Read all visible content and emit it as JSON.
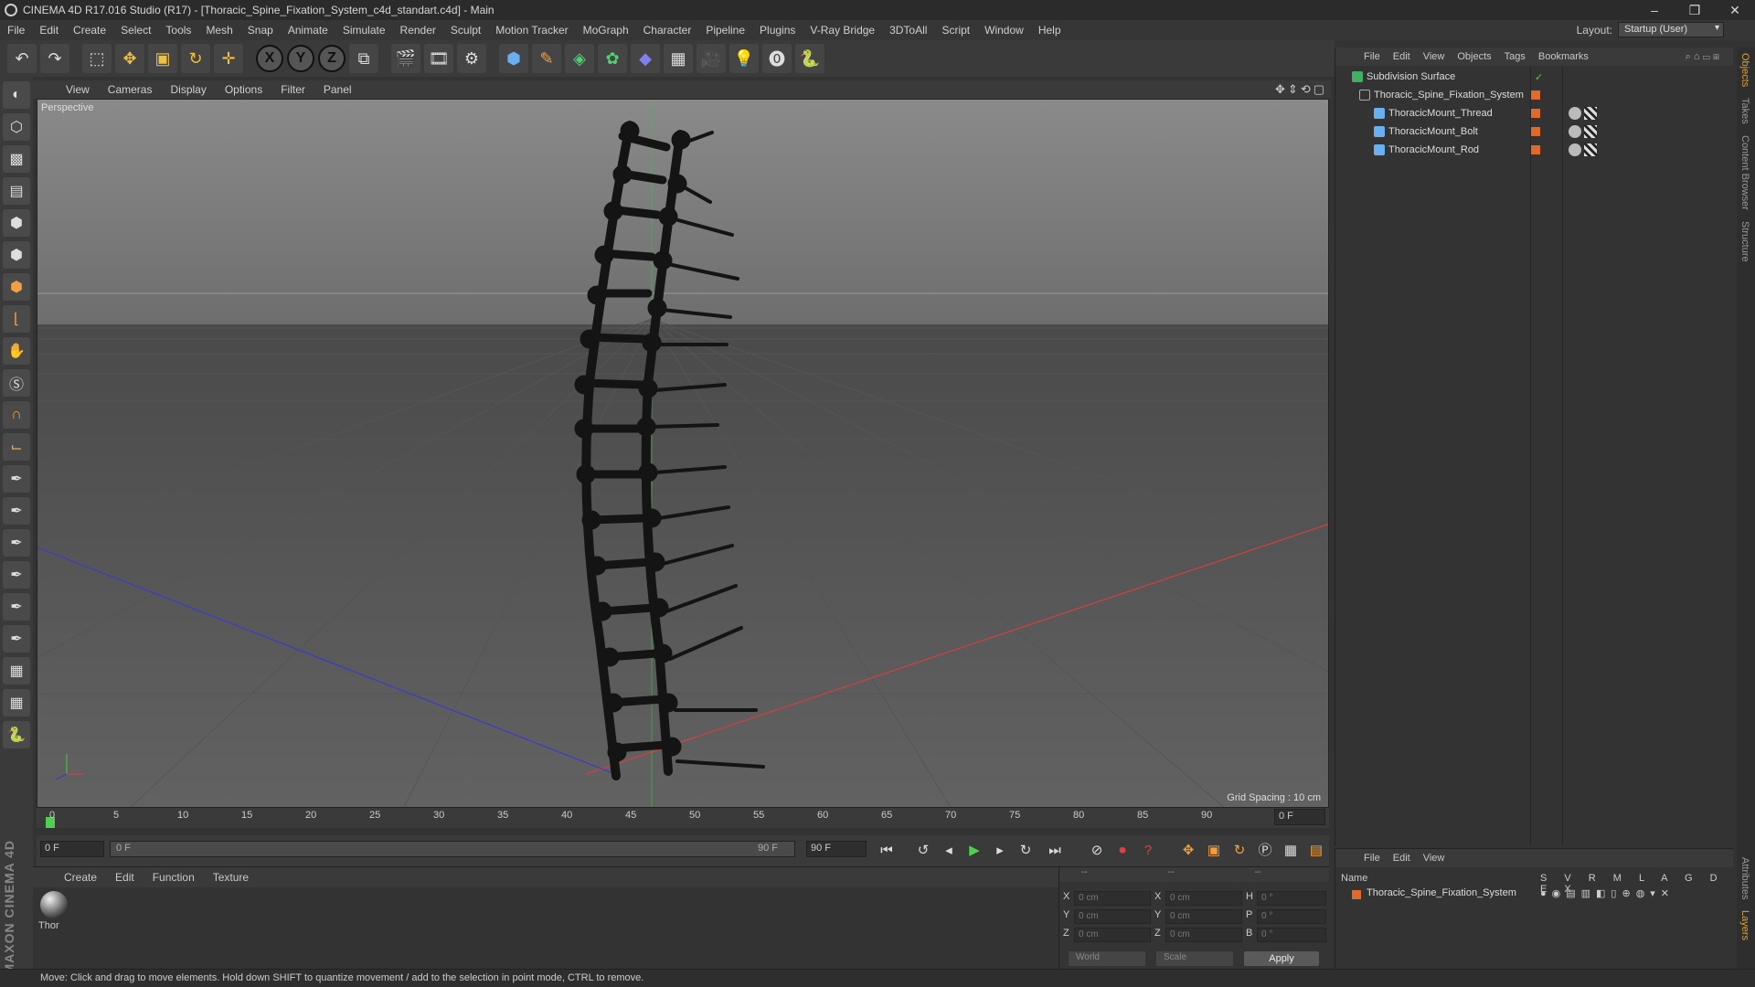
{
  "window": {
    "title": "CINEMA 4D R17.016 Studio (R17) - [Thoracic_Spine_Fixation_System_c4d_standart.c4d] - Main",
    "controls": [
      "–",
      "❐",
      "✕"
    ]
  },
  "menubar": {
    "items": [
      "File",
      "Edit",
      "Create",
      "Select",
      "Tools",
      "Mesh",
      "Snap",
      "Animate",
      "Simulate",
      "Render",
      "Sculpt",
      "Motion Tracker",
      "MoGraph",
      "Character",
      "Pipeline",
      "Plugins",
      "V-Ray Bridge",
      "3DToAll",
      "Script",
      "Window",
      "Help"
    ],
    "layout_label": "Layout:",
    "layout_value": "Startup (User)"
  },
  "toolbar": {
    "axis_x": "X",
    "axis_y": "Y",
    "axis_z": "Z"
  },
  "viewport": {
    "menu": [
      "View",
      "Cameras",
      "Display",
      "Options",
      "Filter",
      "Panel"
    ],
    "camera_label": "Perspective",
    "grid_spacing": "Grid Spacing : 10 cm"
  },
  "timeline": {
    "ticks": [
      "0",
      "5",
      "10",
      "15",
      "20",
      "25",
      "30",
      "35",
      "40",
      "45",
      "50",
      "55",
      "60",
      "65",
      "70",
      "75",
      "80",
      "85",
      "90"
    ],
    "current_frame": "0 F"
  },
  "transport": {
    "start_field": "0 F",
    "slider_start": "0 F",
    "slider_end": "90 F",
    "end_field": "90 F"
  },
  "materials": {
    "menu": [
      "Create",
      "Edit",
      "Function",
      "Texture"
    ],
    "material_name": "Thor"
  },
  "coords": {
    "header": [
      "--",
      "--",
      "--"
    ],
    "rows": [
      {
        "axis": "X",
        "pos": "0 cm",
        "axis2": "X",
        "size": "0 cm",
        "rot_axis": "H",
        "rot": "0 °"
      },
      {
        "axis": "Y",
        "pos": "0 cm",
        "axis2": "Y",
        "size": "0 cm",
        "rot_axis": "P",
        "rot": "0 °"
      },
      {
        "axis": "Z",
        "pos": "0 cm",
        "axis2": "Z",
        "size": "0 cm",
        "rot_axis": "B",
        "rot": "0 °"
      }
    ],
    "mode": "World",
    "transform": "Scale",
    "apply": "Apply"
  },
  "object_manager": {
    "menu": [
      "File",
      "Edit",
      "View",
      "Objects",
      "Tags",
      "Bookmarks"
    ],
    "objects": [
      {
        "name": "Subdivision Surface",
        "depth": 0
      },
      {
        "name": "Thoracic_Spine_Fixation_System",
        "depth": 1
      },
      {
        "name": "ThoracicMount_Thread",
        "depth": 2
      },
      {
        "name": "ThoracicMount_Bolt",
        "depth": 2
      },
      {
        "name": "ThoracicMount_Rod",
        "depth": 2
      }
    ]
  },
  "layers": {
    "menu": [
      "File",
      "Edit",
      "View"
    ],
    "name_header": "Name",
    "columns": "S V R M L A G D E X",
    "layer_name": "Thoracic_Spine_Fixation_System"
  },
  "side_tabs": [
    "Objects",
    "Takes",
    "Content Browser",
    "Structure"
  ],
  "side_tabs_bottom": [
    "Attributes",
    "Layers"
  ],
  "branding": "MAXON CINEMA 4D",
  "status": "Move: Click and drag to move elements. Hold down SHIFT to quantize movement / add to the selection in point mode, CTRL to remove.",
  "colors": {
    "x_axis": "#d04040",
    "z_axis": "#3a3ad0",
    "y_axis": "#40c040",
    "tag_orange": "#e06a2a"
  }
}
